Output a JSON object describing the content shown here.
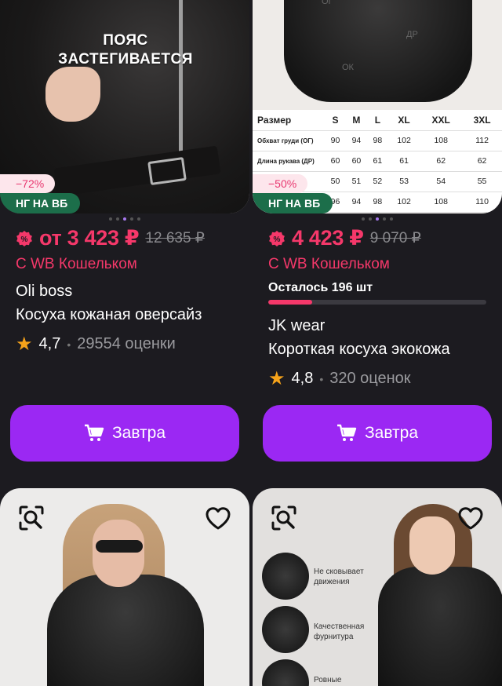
{
  "cards": [
    {
      "overlay_text": "ПОЯС\nЗАСТЕГИВАЕТСЯ",
      "discount": "−72%",
      "promo": "НГ НА ВБ",
      "price": "от 3 423 ₽",
      "old_price": "12 635 ₽",
      "wallet": "С WB Кошельком",
      "brand": "Oli boss",
      "title": "Косуха кожаная оверсайз",
      "rating": "4,7",
      "reviews": "29554 оценки",
      "cta": "Завтра"
    },
    {
      "discount": "−50%",
      "promo": "НГ НА ВБ",
      "price": "4 423 ₽",
      "old_price": "9 070 ₽",
      "wallet": "С WB Кошельком",
      "stock_label": "Осталось 196 шт",
      "stock_fraction": 0.2,
      "brand": "JK wear",
      "title": "Короткая косуха экокожа",
      "rating": "4,8",
      "reviews": "320 оценок",
      "cta": "Завтра",
      "size_table": {
        "labels": {
          "og": "ОГ",
          "dr": "ДР",
          "ok": "ОК"
        },
        "header": [
          "Размер",
          "S",
          "M",
          "L",
          "XL",
          "XXL",
          "3XL"
        ],
        "rows": [
          [
            "Обхват груди (ОГ)",
            "90",
            "94",
            "98",
            "102",
            "108",
            "112"
          ],
          [
            "Длина рукава (ДР)",
            "60",
            "60",
            "61",
            "61",
            "62",
            "62"
          ],
          [
            "ДИ)",
            "50",
            "51",
            "52",
            "53",
            "54",
            "55"
          ],
          [
            "",
            "96",
            "94",
            "98",
            "102",
            "108",
            "110"
          ]
        ]
      }
    }
  ],
  "lower_features": [
    "Не сковывает движения",
    "Качественная фурнитура",
    "Ровные"
  ],
  "colors": {
    "accent_purple": "#9b28f3",
    "price_pink": "#f5386a",
    "promo_green": "#1c6e4a",
    "star": "#f6a31a",
    "bg": "#1c1b20"
  }
}
